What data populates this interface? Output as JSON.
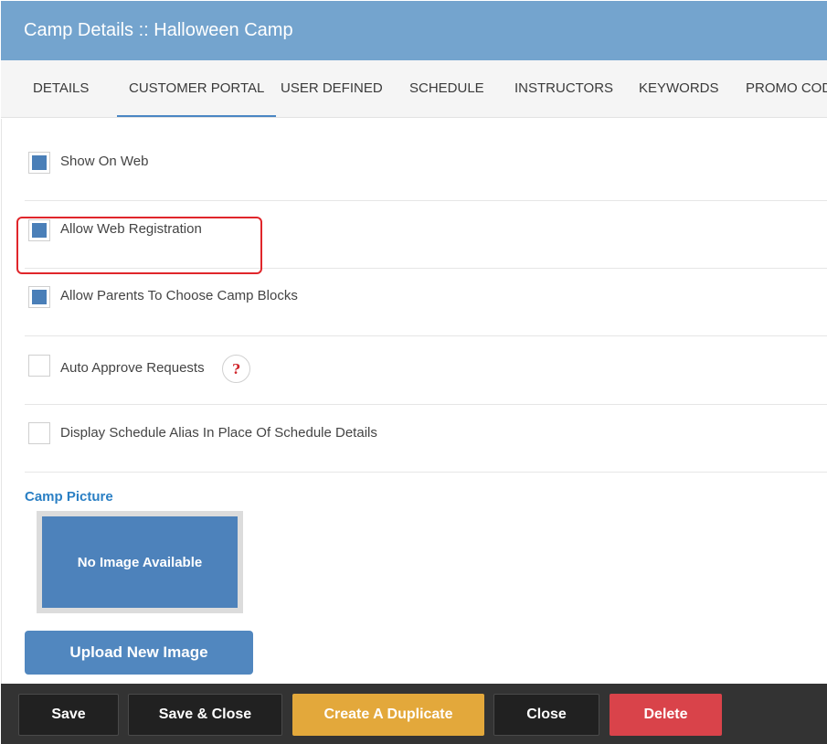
{
  "header": {
    "title": "Camp Details :: Halloween Camp"
  },
  "tabs": [
    {
      "label": "DETAILS",
      "active": false
    },
    {
      "label": "CUSTOMER PORTAL",
      "active": true
    },
    {
      "label": "USER DEFINED",
      "active": false
    },
    {
      "label": "SCHEDULE",
      "active": false
    },
    {
      "label": "INSTRUCTORS",
      "active": false
    },
    {
      "label": "KEYWORDS",
      "active": false
    },
    {
      "label": "PROMO CODES",
      "active": false
    }
  ],
  "options": [
    {
      "label": "Show On Web",
      "checked": true
    },
    {
      "label": "Allow Web Registration",
      "checked": true
    },
    {
      "label": "Allow Parents To Choose Camp Blocks",
      "checked": true
    },
    {
      "label": "Auto Approve Requests",
      "checked": false,
      "help": "?"
    },
    {
      "label": "Display Schedule Alias In Place Of Schedule Details",
      "checked": false
    }
  ],
  "picture": {
    "label": "Camp Picture",
    "placeholder": "No Image Available",
    "upload_label": "Upload New Image"
  },
  "footer": {
    "save": "Save",
    "save_close": "Save & Close",
    "duplicate": "Create A Duplicate",
    "close": "Close",
    "delete": "Delete"
  },
  "colors": {
    "header": "#74a4ce",
    "accent": "#4a86c3",
    "highlight": "#e0262b",
    "duplicate": "#e3a83b",
    "delete": "#d9434a"
  }
}
